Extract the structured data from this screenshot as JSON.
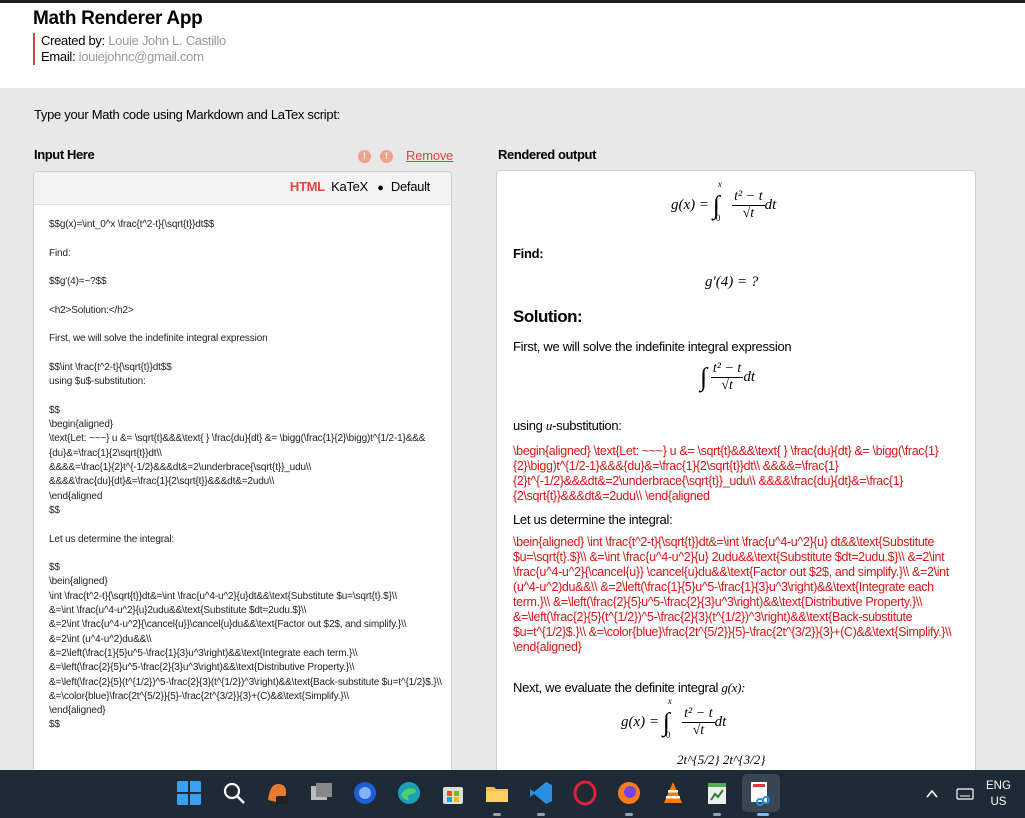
{
  "header": {
    "app_title": "Math Renderer App",
    "created_by_label": "Created by:",
    "created_by_value": "Louie John L. Castillo",
    "email_label": "Email:",
    "email_value": "louiejohnc@gmail.com"
  },
  "instruction": "Type your Math code using Markdown and LaTex script:",
  "input": {
    "label": "Input Here",
    "remove_label": "Remove",
    "dot1": "!",
    "dot2": "!",
    "mode_html": "HTML",
    "mode_katex": "KaTeX",
    "mode_bullet": "●",
    "mode_default": "Default",
    "code": "$$g(x)=\\int_0^x \\frac{t^2-t}{\\sqrt{t}}dt$$\n\nFind:\n\n$$g'(4)=~?$$\n\n<h2>Solution:</h2>\n\nFirst, we will solve the indefinite integral expression\n\n$$\\int \\frac{t^2-t}{\\sqrt{t}}dt$$\nusing $u$-substitution:\n\n$$\n\\begin{aligned}\n\\text{Let: ~~~} u &= \\sqrt{t}&&&\\text{ } \\frac{du}{dt} &= \\bigg(\\frac{1}{2}\\bigg)t^{1/2-1}&&&{du}&=\\frac{1}{2\\sqrt{t}}dt\\\\\n&&&&=\\frac{1}{2}t^{-1/2}&&&dt&=2\\underbrace{\\sqrt{t}}_udu\\\\\n&&&&\\frac{du}{dt}&=\\frac{1}{2\\sqrt{t}}&&&dt&=2udu\\\\\n\\end{aligned\n$$\n\nLet us determine the integral:\n\n$$\n\\bein{aligned}\n\\int \\frac{t^2-t}{\\sqrt{t}}dt&=\\int \\frac{u^4-u^2}{u}dt&&\\text{Substitute $u=\\sqrt{t}.$}\\\\\n&=\\int \\frac{u^4-u^2}{u}2udu&&\\text{Substitute $dt=2udu.$}\\\\\n&=2\\int \\frac{u^4-u^2}{\\cancel{u}}\\cancel{u}du&&\\text{Factor out $2$, and simplify.}\\\\\n&=2\\int (u^4-u^2)du&&\\\\\n&=2\\left(\\frac{1}{5}u^5-\\frac{1}{3}u^3\\right)&&\\text{Integrate each term.}\\\\\n&=\\left(\\frac{2}{5}u^5-\\frac{2}{3}u^3\\right)&&\\text{Distributive Property.}\\\\\n&=\\left(\\frac{2}{5}(t^{1/2})^5-\\frac{2}{3}(t^{1/2})^3\\right)&&\\text{Back-substitute $u=t^{1/2}$.}\\\\\n&=\\color{blue}\\frac{2t^{5/2}}{5}-\\frac{2t^{3/2}}{3}+(C)&&\\text{Simplify.}\\\\\n\\end{aligned}\n$$"
  },
  "output": {
    "label": "Rendered output",
    "find": "Find:",
    "solution_heading": "Solution:",
    "first_line": "First, we will solve the indefinite integral expression",
    "using_prefix": "using ",
    "using_var": "u",
    "using_suffix": "-substitution:",
    "raw_block_1": "\\begin{aligned} \\text{Let: ~~~} u &= \\sqrt{t}&&&\\text{ } \\frac{du}{dt} &= \\bigg(\\frac{1}{2}\\bigg)t^{1/2-1}&&&{du}&=\\frac{1}{2\\sqrt{t}}dt\\\\ &&&&=\\frac{1}{2}t^{-1/2}&&&dt&=2\\underbrace{\\sqrt{t}}_udu\\\\ &&&&\\frac{du}{dt}&=\\frac{1}{2\\sqrt{t}}&&&dt&=2udu\\\\ \\end{aligned",
    "determine_line": "Let us determine the integral:",
    "raw_block_2": "\\bein{aligned} \\int \\frac{t^2-t}{\\sqrt{t}}dt&=\\int \\frac{u^4-u^2}{u} dt&&\\text{Substitute $u=\\sqrt{t}.$}\\\\ &=\\int \\frac{u^4-u^2}{u} 2udu&&\\text{Substitute $dt=2udu.$}\\\\ &=2\\int \\frac{u^4-u^2}{\\cancel{u}} \\cancel{u}du&&\\text{Factor out $2$, and simplify.}\\\\ &=2\\int (u^4-u^2)du&&\\\\ &=2\\left(\\frac{1}{5}u^5-\\frac{1}{3}u^3\\right)&&\\text{Integrate each term.}\\\\ &=\\left(\\frac{2}{5}u^5-\\frac{2}{3}u^3\\right)&&\\text{Distributive Property.}\\\\ &=\\left(\\frac{2}{5}(t^{1/2})^5-\\frac{2}{3}(t^{1/2})^3\\right)&&\\text{Back-substitute $u=t^{1/2}$.}\\\\ &=\\color{blue}\\frac{2t^{5/2}}{5}-\\frac{2t^{3/2}}{3}+(C)&&\\text{Simplify.}\\\\ \\end{aligned}",
    "next_prefix": "Next, we evaluate the definite integral ",
    "next_math": "g(x):",
    "eq1_lhs": "g(x) = ",
    "eq1_num": "t² − t",
    "eq1_den": "√t",
    "eq1_upper": "x",
    "eq1_lower": "0",
    "eq1_dt": "dt",
    "eq2": "g′(4) = ?",
    "eq3_num": "t² − t",
    "eq3_den": "√t",
    "eq3_dt": "dt",
    "eq4_lhs": "g(x) = ",
    "eq4_num": "t² − t",
    "eq4_den": "√t",
    "eq4_upper": "x",
    "eq4_lower": "0",
    "eq4_dt": "dt",
    "eq5_partial": "2t^{5/2}    2t^{3/2}"
  },
  "taskbar": {
    "lang_top": "ENG",
    "lang_bottom": "US",
    "icons": [
      "windows-start",
      "search",
      "copilot-pre",
      "task-view",
      "firefox-dev",
      "edge",
      "microsoft-store",
      "file-explorer",
      "vs-code",
      "opera",
      "firefox",
      "vlc",
      "notepad-app",
      "snipping-tool"
    ]
  },
  "colors": {
    "accent_red": "#d41818",
    "html_mode": "#e0483a",
    "taskbar": "#1f2a37"
  }
}
